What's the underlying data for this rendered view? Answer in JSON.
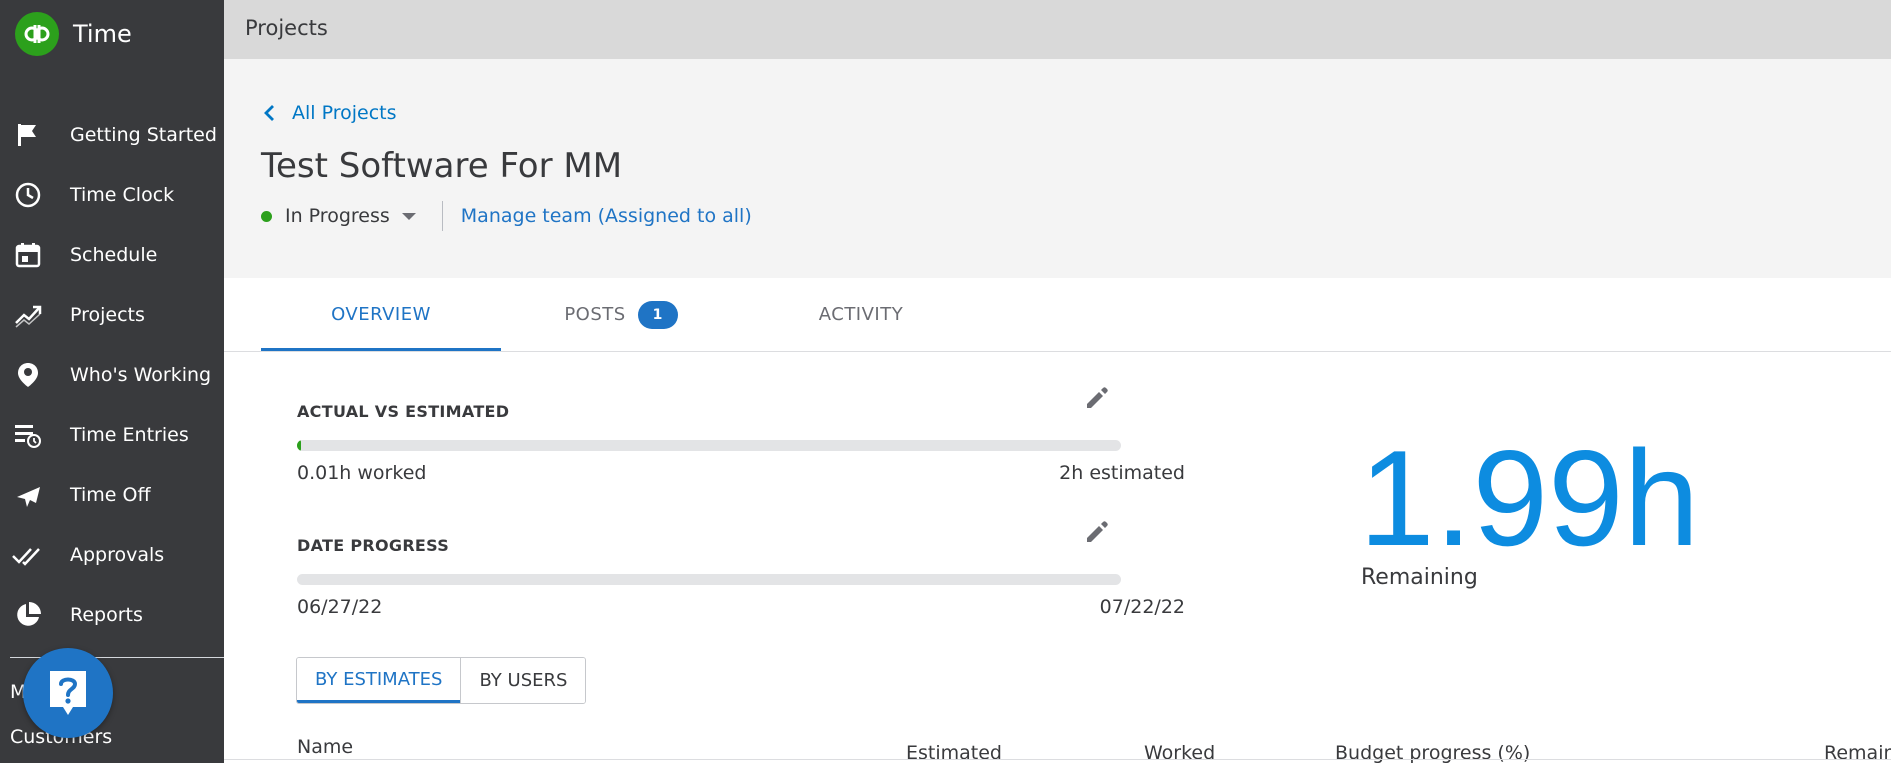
{
  "app": {
    "name": "Time"
  },
  "sidebar": {
    "items": [
      {
        "label": "Getting Started",
        "icon": "flag-icon"
      },
      {
        "label": "Time Clock",
        "icon": "clock-icon"
      },
      {
        "label": "Schedule",
        "icon": "calendar-icon"
      },
      {
        "label": "Projects",
        "icon": "trending-icon"
      },
      {
        "label": "Who's Working",
        "icon": "map-pin-icon"
      },
      {
        "label": "Time Entries",
        "icon": "time-entries-icon"
      },
      {
        "label": "Time Off",
        "icon": "airplane-icon"
      },
      {
        "label": "Approvals",
        "icon": "double-check-icon"
      },
      {
        "label": "Reports",
        "icon": "pie-chart-icon"
      }
    ],
    "truncated_item": "M",
    "customers": "Customers"
  },
  "topbar": {
    "title": "Projects"
  },
  "project": {
    "back_label": "All Projects",
    "title": "Test Software For MM",
    "status": "In Progress",
    "status_color": "#2ca01c",
    "team_link": "Manage team (Assigned to all)"
  },
  "tabs": [
    {
      "label": "OVERVIEW",
      "active": true
    },
    {
      "label": "POSTS",
      "badge": "1"
    },
    {
      "label": "ACTIVITY"
    }
  ],
  "overview": {
    "actual_vs_estimated": {
      "label": "ACTUAL VS ESTIMATED",
      "worked": "0.01h worked",
      "estimated": "2h estimated",
      "progress": 0.005
    },
    "date_progress": {
      "label": "DATE PROGRESS",
      "start": "06/27/22",
      "end": "07/22/22",
      "progress": 0
    },
    "remaining": {
      "value": "1.99h",
      "label": "Remaining"
    }
  },
  "view_toggle": [
    {
      "label": "BY ESTIMATES",
      "active": true
    },
    {
      "label": "BY USERS"
    }
  ],
  "table": {
    "headers": [
      "Name",
      "Estimated",
      "Worked",
      "Budget progress (%)",
      "Remain"
    ]
  },
  "colors": {
    "accent": "#1f74c5",
    "sidebar_bg": "#393a3d",
    "brand_green": "#2ca01c",
    "remaining_blue": "#0d8ce0"
  }
}
